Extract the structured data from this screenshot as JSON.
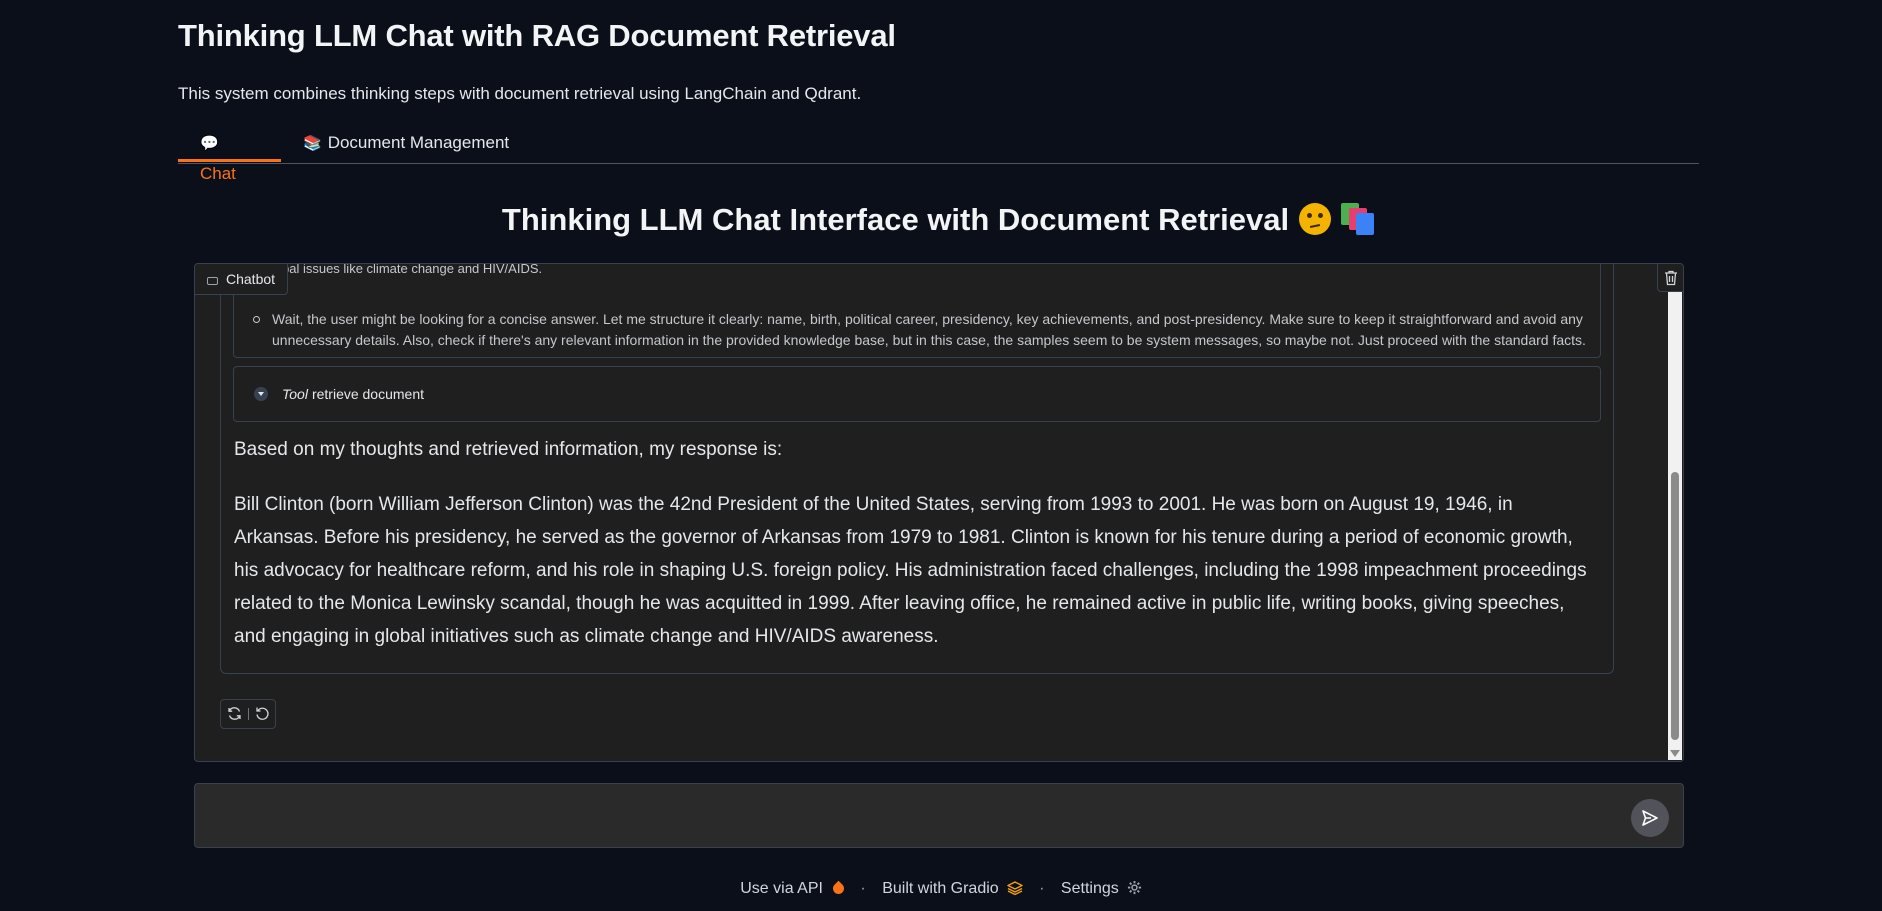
{
  "app": {
    "title": "Thinking LLM Chat with RAG Document Retrieval",
    "description": "This system combines thinking steps with document retrieval using LangChain and Qdrant."
  },
  "tabs": [
    {
      "label": "Chat",
      "icon": "speech-bubble-icon",
      "active": true
    },
    {
      "label": "Document Management",
      "icon": "books-icon",
      "active": false
    }
  ],
  "chat": {
    "heading": "Thinking LLM Chat Interface with Document Retrieval",
    "chatbot_label": "Chatbot",
    "thought_partial": "bal issues like climate change and HIV/AIDS.",
    "thought_bullet": "Wait, the user might be looking for a concise answer. Let me structure it clearly: name, birth, political career, presidency, key achievements, and post-presidency. Make sure to keep it straightforward and avoid any unnecessary details. Also, check if there's any relevant information in the provided knowledge base, but in this case, the samples seem to be system messages, so maybe not. Just proceed with the standard facts.",
    "tool_label": "Tool",
    "tool_name": "retrieve document",
    "response_intro": "Based on my thoughts and retrieved information, my response is:",
    "response_body": "Bill Clinton (born William Jefferson Clinton) was the 42nd President of the United States, serving from 1993 to 2001. He was born on August 19, 1946, in Arkansas. Before his presidency, he served as the governor of Arkansas from 1979 to 1981. Clinton is known for his tenure during a period of economic growth, his advocacy for healthcare reform, and his role in shaping U.S. foreign policy. His administration faced challenges, including the 1998 impeachment proceedings related to the Monica Lewinsky scandal, though he was acquitted in 1999. After leaving office, he remained active in public life, writing books, giving speeches, and engaging in global initiatives such as climate change and HIV/AIDS awareness."
  },
  "input": {
    "value": "",
    "placeholder": ""
  },
  "footer": {
    "api": "Use via API",
    "built": "Built with Gradio",
    "settings": "Settings",
    "separator": "·"
  },
  "colors": {
    "accent": "#f97316",
    "background": "#0b0f19",
    "panel": "#1f1f1f"
  }
}
